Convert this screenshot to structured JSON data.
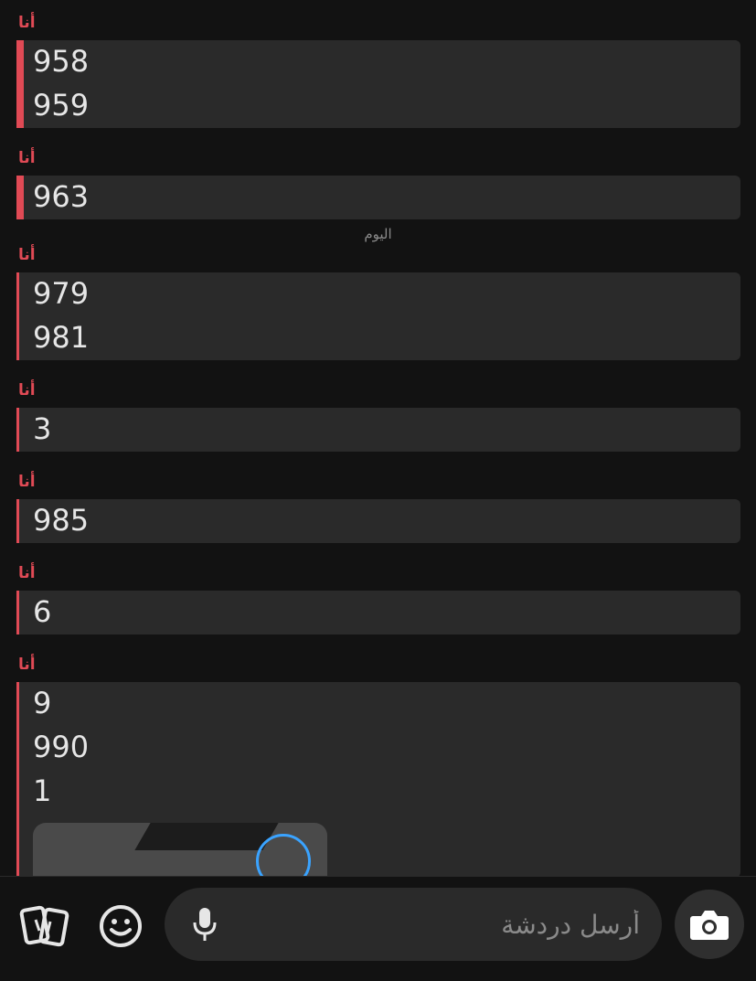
{
  "messages": [
    {
      "sender": "أنا",
      "lines": [
        "958",
        "959"
      ]
    },
    {
      "sender": "أنا",
      "lines": [
        "963"
      ]
    },
    {
      "date_separator": "اليوم"
    },
    {
      "sender": "أنا",
      "lines": [
        "979",
        "981"
      ]
    },
    {
      "sender": "أنا",
      "lines": [
        "3"
      ]
    },
    {
      "sender": "أنا",
      "lines": [
        "985"
      ]
    },
    {
      "sender": "أنا",
      "lines": [
        "6"
      ]
    },
    {
      "sender": "أنا",
      "lines": [
        "9",
        "990",
        "1"
      ],
      "has_media": true
    }
  ],
  "composer": {
    "placeholder": "أرسل دردشة"
  },
  "icons": {
    "cards": "cards-icon",
    "emoji": "emoji-icon",
    "mic": "microphone-icon",
    "camera": "camera-icon"
  },
  "colors": {
    "accent": "#e04a55",
    "background": "#121212",
    "bubble": "#2a2a2a",
    "text": "#e6e6e6",
    "muted": "#8a8a8a"
  }
}
